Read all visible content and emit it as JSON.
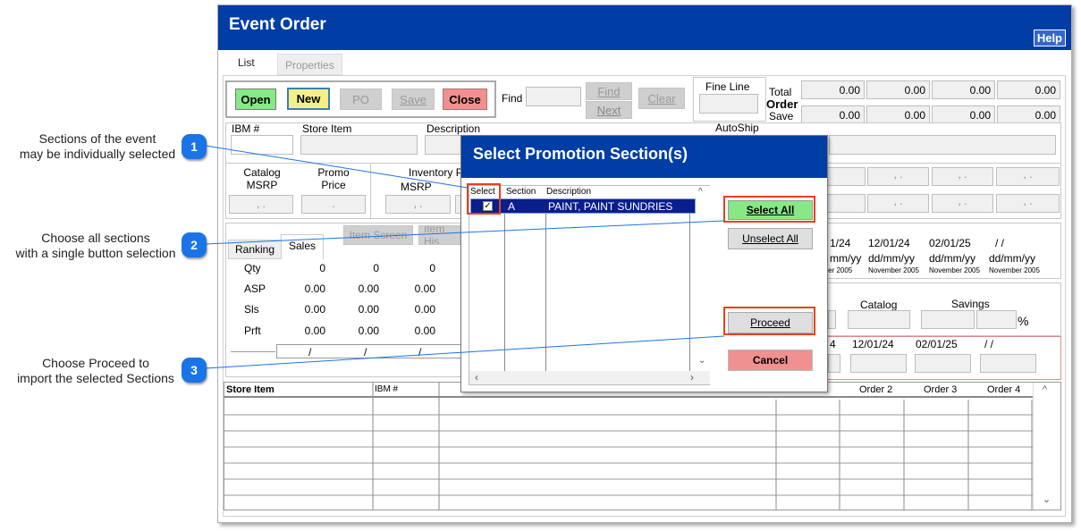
{
  "callouts": [
    {
      "number": "1",
      "line1": "Sections of the event",
      "line2": "may be individually selected"
    },
    {
      "number": "2",
      "line1": "Choose all sections",
      "line2": "with a single button selection"
    },
    {
      "number": "3",
      "line1": "Choose Proceed to",
      "line2": "import the selected Sections"
    }
  ],
  "window": {
    "title": "Event Order",
    "help_label": "Help",
    "tabs": [
      {
        "label": "List"
      },
      {
        "label": "Properties"
      }
    ]
  },
  "toolbar": {
    "open": "Open",
    "new": "New",
    "po": "PO",
    "save": "Save",
    "close": "Close",
    "find_label": "Find",
    "find_value": "",
    "find_btn": "Find",
    "next_btn": "Next",
    "clear_btn": "Clear",
    "fine_line_label": "Fine Line",
    "fine_line_value": ""
  },
  "totals": {
    "total_label": "Total",
    "order_label": "Order",
    "save_label": "Save",
    "total_values": [
      "0.00",
      "0.00",
      "0.00",
      "0.00"
    ],
    "save_values": [
      "0.00",
      "0.00",
      "0.00",
      "0.00"
    ]
  },
  "item": {
    "ibm_label": "IBM #",
    "store_item_label": "Store Item",
    "description_label": "Description",
    "autoship_label": "AutoShip",
    "catalog_msrp_label1": "Catalog",
    "catalog_msrp_label2": "MSRP",
    "promo_price_label1": "Promo",
    "promo_price_label2": "Price",
    "inventory_label": "Inventory P",
    "inv_msrp_label": "MSRP",
    "catalog_msrp_value": ", .",
    "promo_price_value": ".",
    "inv_msrp_value": ", .",
    "right_fields_row1": [
      ", .",
      ", .",
      ", .",
      ", ."
    ],
    "right_fields_row2": [
      ", .",
      ", .",
      ", .",
      ", ."
    ]
  },
  "sales_tabs": [
    {
      "label": "Ranking"
    },
    {
      "label": "Sales"
    }
  ],
  "sales_buttons": {
    "item_screen": "Item Screen",
    "item_history": "Item His"
  },
  "sales_rows": [
    {
      "label": "Qty",
      "values": [
        "0",
        "0",
        "0"
      ]
    },
    {
      "label": "ASP",
      "values": [
        "0.00",
        "0.00",
        "0.00"
      ]
    },
    {
      "label": "Sls",
      "values": [
        "0.00",
        "0.00",
        "0.00"
      ]
    },
    {
      "label": "Prft",
      "values": [
        "0.00",
        "0.00",
        "0.00"
      ]
    }
  ],
  "sales_dates": [
    "/",
    "/",
    "/"
  ],
  "dates_panel": {
    "dates": [
      "1/24",
      "12/01/24",
      "02/01/25",
      "/  /"
    ],
    "formats": [
      "mm/yy",
      "dd/mm/yy",
      "dd/mm/yy",
      "dd/mm/yy"
    ],
    "months": [
      "mber 2005",
      "November 2005",
      "November 2005",
      "November 2005"
    ]
  },
  "pricing": {
    "catalog_label": "Catalog",
    "savings_label": "Savings",
    "percent_label": "%"
  },
  "order_dates": [
    "4",
    "12/01/24",
    "02/01/25",
    "/  /"
  ],
  "table": {
    "columns": [
      "Store Item",
      "IBM #",
      "",
      "",
      "Order 2",
      "Order 3",
      "Order 4"
    ]
  },
  "dialog": {
    "title": "Select Promotion Section(s)",
    "columns": [
      "Select",
      "Section",
      "Description"
    ],
    "rows": [
      {
        "selected": true,
        "section": "A",
        "description": "PAINT, PAINT SUNDRIES"
      }
    ],
    "select_all": "Select All",
    "unselect_all": "Unselect All",
    "proceed": "Proceed",
    "cancel": "Cancel"
  },
  "colors": {
    "title_bar": "#003da5",
    "callout_badge": "#1a74e8",
    "highlight_box": "#e8411c",
    "select_all_btn": "#87e887",
    "cancel_btn": "#f09090"
  }
}
